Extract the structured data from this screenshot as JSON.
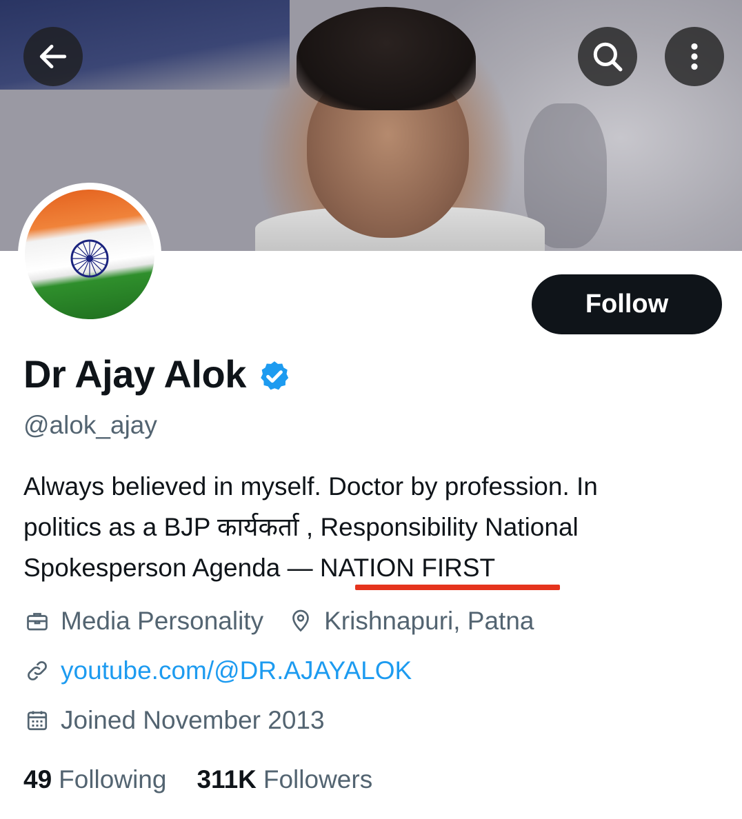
{
  "profile": {
    "display_name": "Dr Ajay Alok",
    "handle": "@alok_ajay",
    "bio_line1": "Always believed in myself. Doctor by profession. In",
    "bio_line2": "politics as a BJP कार्यकर्ता , Responsibility National",
    "bio_line3_prefix": "Spokesperson Agenda — ",
    "bio_line3_highlight": "NATION FIRST",
    "category": "Media Personality",
    "location": "Krishnapuri, Patna",
    "website": "youtube.com/@DR.AJAYALOK",
    "joined": "Joined November 2013"
  },
  "actions": {
    "follow_label": "Follow"
  },
  "stats": {
    "following_count": "49",
    "following_label": "Following",
    "followers_count": "311K",
    "followers_label": "Followers"
  },
  "icons": {
    "back": "arrow-left-icon",
    "search": "search-icon",
    "more": "more-vertical-icon",
    "verified": "verified-badge-icon",
    "category": "briefcase-icon",
    "location": "location-pin-icon",
    "website": "link-icon",
    "joined": "calendar-icon"
  },
  "colors": {
    "accent": "#1d9bf0",
    "text": "#0f1419",
    "secondary": "#536471",
    "highlight_underline": "#e5341d",
    "follow_bg": "#0f1419"
  }
}
